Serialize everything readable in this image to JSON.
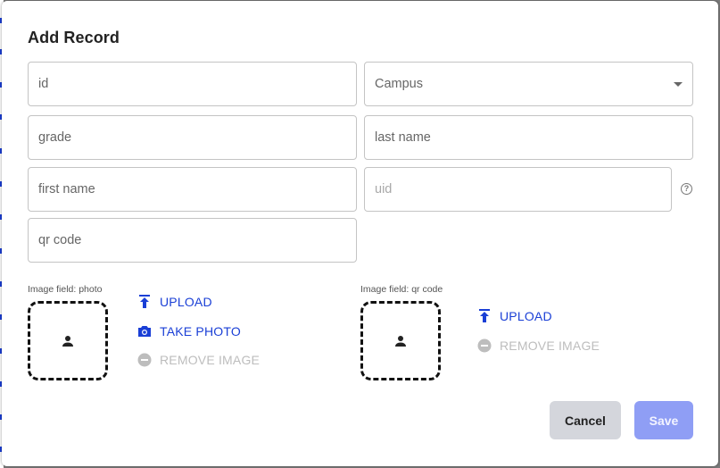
{
  "dialog": {
    "title": "Add Record"
  },
  "fields": {
    "id": "id",
    "campus": "Campus",
    "grade": "grade",
    "last_name": "last name",
    "first_name": "first name",
    "uid": "uid",
    "qr_code": "qr code"
  },
  "image_fields": {
    "photo": {
      "label": "Image field: photo",
      "upload": "UPLOAD",
      "take_photo": "TAKE PHOTO",
      "remove": "REMOVE IMAGE"
    },
    "qr_code": {
      "label": "Image field: qr code",
      "upload": "UPLOAD",
      "remove": "REMOVE IMAGE"
    }
  },
  "buttons": {
    "cancel": "Cancel",
    "save": "Save"
  },
  "colors": {
    "accent": "#1a3fd6",
    "save_button": "#8f9ef5",
    "cancel_button": "#d4d6dc",
    "disabled": "#bdbdbd"
  },
  "icons": {
    "upload": "upload-icon",
    "camera": "camera-icon",
    "remove": "remove-circle-icon",
    "person": "person-icon",
    "help": "help-circle-icon",
    "dropdown": "caret-down-icon"
  }
}
